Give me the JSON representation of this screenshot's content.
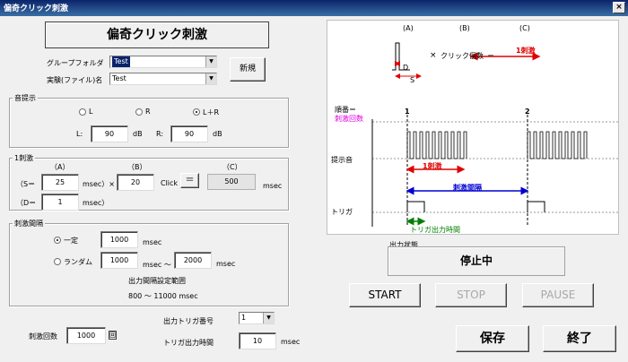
{
  "window": {
    "title": "偏奇クリック刺激",
    "close": "×"
  },
  "header": {
    "title": "偏奇クリック刺激",
    "new_button": "新規"
  },
  "group_folder": {
    "label": "グループフォルダ",
    "value": "Test"
  },
  "experiment_file": {
    "label": "実験(ファイル)名",
    "value": "Test"
  },
  "sound": {
    "title": "音提示",
    "options": [
      "L",
      "R",
      "L＋R"
    ],
    "selected": "L＋R",
    "l_label": "L:",
    "l_value": "90",
    "l_unit": "dB",
    "r_label": "R:",
    "r_value": "90",
    "r_unit": "dB"
  },
  "stimulus": {
    "title": "1刺激",
    "a_label": "（A）",
    "b_label": "（B）",
    "c_label": "（C）",
    "s_label": "（S＝",
    "s_value": "25",
    "s_unit": "msec）×",
    "b_value": "20",
    "b_unit": "Click",
    "equals": "＝",
    "c_value": "500",
    "c_unit": "msec",
    "d_label": "（D＝",
    "d_value": "1",
    "d_unit": "msec）"
  },
  "interval": {
    "title": "刺激間隔",
    "fixed_label": "一定",
    "fixed_value": "1000",
    "fixed_unit": "msec",
    "random_label": "ランダム",
    "random_min": "1000",
    "random_mid": "msec 〜",
    "random_max": "2000",
    "random_unit": "msec",
    "range_title": "出力間隔設定範囲",
    "range_value": "800 〜 11000 msec"
  },
  "count": {
    "label": "刺激回数",
    "value": "1000",
    "unit": "回"
  },
  "trigger": {
    "number_label": "出力トリガ番号",
    "number_value": "1",
    "time_label": "トリガ出力時間",
    "time_value": "10",
    "time_unit": "msec"
  },
  "diagram": {
    "a": "(A)",
    "b": "(B)",
    "c": "(C)",
    "times": "×",
    "click_count": "クリック個数",
    "eq": "＝",
    "one_stim_top": "1刺激",
    "d": "D",
    "s": "S",
    "order_label": "順番＝",
    "count_label": "刺激回数",
    "num1": "1",
    "num2": "2",
    "sound_row": "提示音",
    "one_stim": "1刺激",
    "interval": "刺激間隔",
    "trigger_row": "トリガ",
    "trigger_time": "トリガ出力時間",
    "colors": {
      "red": "#e00000",
      "blue": "#0000d0",
      "green": "#008000",
      "magenta": "#e000e0"
    }
  },
  "status": {
    "title": "出力状態",
    "value": "停止中"
  },
  "controls": {
    "start": "START",
    "stop": "STOP",
    "pause": "PAUSE",
    "save": "保存",
    "exit": "終了"
  }
}
